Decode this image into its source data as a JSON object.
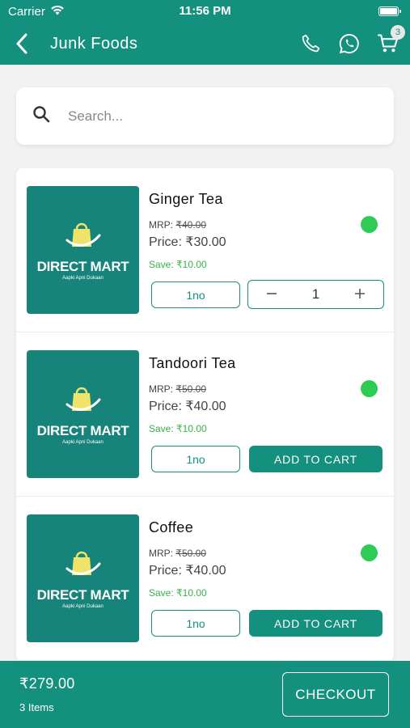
{
  "status": {
    "carrier": "Carrier",
    "time": "11:56 PM"
  },
  "header": {
    "title": "Junk Foods",
    "cart_count": "3"
  },
  "search": {
    "placeholder": "Search..."
  },
  "products": [
    {
      "name": "Ginger Tea",
      "mrp_label": "MRP:",
      "mrp": "₹40.00",
      "price": "Price: ₹30.00",
      "save": "Save: ₹10.00",
      "unit": "1no",
      "in_cart": true,
      "quantity": "1",
      "brand": "DIRECT MART",
      "tagline": "Aapki Apni Dukaan"
    },
    {
      "name": "Tandoori Tea",
      "mrp_label": "MRP:",
      "mrp": "₹50.00",
      "price": "Price: ₹40.00",
      "save": "Save: ₹10.00",
      "unit": "1no",
      "in_cart": false,
      "add_label": "ADD TO CART",
      "brand": "DIRECT MART",
      "tagline": "Aapki Apni Dukaan"
    },
    {
      "name": "Coffee",
      "mrp_label": "MRP:",
      "mrp": "₹50.00",
      "price": "Price: ₹40.00",
      "save": "Save: ₹10.00",
      "unit": "1no",
      "in_cart": false,
      "add_label": "ADD TO CART",
      "brand": "DIRECT MART",
      "tagline": "Aapki Apni Dukaan"
    }
  ],
  "footer": {
    "total": "₹279.00",
    "items": "3 Items",
    "checkout_label": "CHECKOUT"
  },
  "colors": {
    "primary": "#14907f",
    "available": "#2ecc55",
    "save": "#36b24a"
  },
  "icons": [
    "back-arrow-icon",
    "phone-icon",
    "whatsapp-icon",
    "cart-icon",
    "search-icon",
    "shopping-bag-logo-icon"
  ]
}
